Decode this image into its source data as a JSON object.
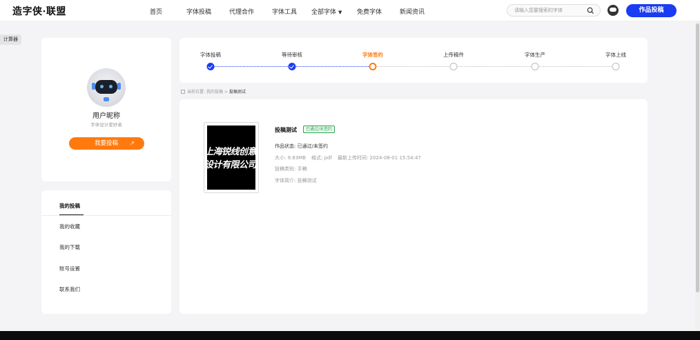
{
  "header": {
    "logo_text": "造字侠·联盟",
    "nav": [
      "首页",
      "字体投稿",
      "代理合作",
      "字体工具",
      "全部字体",
      "免费字体",
      "新闻资讯"
    ],
    "search_placeholder": "请输入您要搜索的字体",
    "submit_label": "作品投稿"
  },
  "side_tag": "计算器",
  "profile": {
    "nickname": "用户昵称",
    "subtitle": "字体设计爱好者",
    "button": "我要投稿",
    "button_arrow": "↗"
  },
  "menu": [
    "我的投稿",
    "我的收藏",
    "我的下载",
    "账号设置",
    "联系我们"
  ],
  "steps": [
    {
      "label": "字体投稿",
      "state": "done"
    },
    {
      "label": "等待审核",
      "state": "done"
    },
    {
      "label": "字体签约",
      "state": "current"
    },
    {
      "label": "上传稿件",
      "state": "todo"
    },
    {
      "label": "字体生产",
      "state": "todo"
    },
    {
      "label": "字体上线",
      "state": "todo"
    }
  ],
  "breadcrumb": {
    "prefix": "当前位置:",
    "path1": "我的投稿",
    "sep": ">",
    "current": "投稿测试"
  },
  "submission": {
    "thumbnail_lines": [
      "上海锐线创意",
      "设计有限公司"
    ],
    "title": "投稿测试",
    "badge": "已通过/未签约",
    "status_label": "作品状态:",
    "status_value": "已通过/未签约",
    "size": "大小: 9.83MB",
    "format": "格式: pdf",
    "uploaded": "最新上传时间: 2024-08-01 15:54:47",
    "category": "投稿类别: 手稿",
    "intro": "字体简介: 投稿测试"
  },
  "colors": {
    "brand_blue": "#1a3cf2",
    "accent_orange": "#ff7a0e",
    "success_green": "#2aa44f"
  }
}
